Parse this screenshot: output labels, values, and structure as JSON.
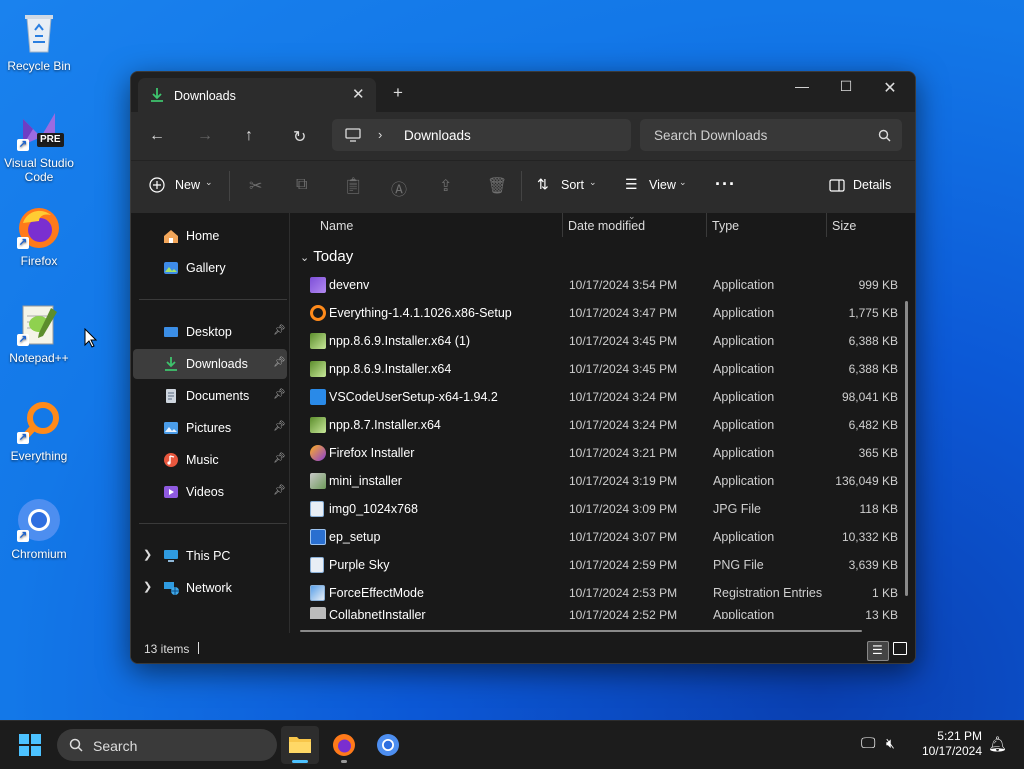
{
  "desktop": {
    "icons": [
      {
        "label": "Recycle Bin"
      },
      {
        "label": "Visual Studio Code"
      },
      {
        "label": "Firefox"
      },
      {
        "label": "Notepad++"
      },
      {
        "label": "Everything"
      },
      {
        "label": "Chromium"
      }
    ],
    "vscode_badge": "PRE"
  },
  "window": {
    "tab_title": "Downloads",
    "address": {
      "location": "Downloads"
    },
    "search": {
      "placeholder": "Search Downloads"
    },
    "commands": {
      "new": "New",
      "sort": "Sort",
      "view": "View",
      "details": "Details"
    },
    "nav": {
      "items": [
        {
          "label": "Home"
        },
        {
          "label": "Gallery"
        },
        {
          "label": "Desktop"
        },
        {
          "label": "Downloads"
        },
        {
          "label": "Documents"
        },
        {
          "label": "Pictures"
        },
        {
          "label": "Music"
        },
        {
          "label": "Videos"
        },
        {
          "label": "This PC"
        },
        {
          "label": "Network"
        }
      ]
    },
    "columns": [
      "Name",
      "Date modified",
      "Type",
      "Size"
    ],
    "group": "Today",
    "files": [
      {
        "name": "devenv",
        "date": "10/17/2024 3:54 PM",
        "type": "Application",
        "size": "999 KB"
      },
      {
        "name": "Everything-1.4.1.1026.x86-Setup",
        "date": "10/17/2024 3:47 PM",
        "type": "Application",
        "size": "1,775 KB"
      },
      {
        "name": "npp.8.6.9.Installer.x64 (1)",
        "date": "10/17/2024 3:45 PM",
        "type": "Application",
        "size": "6,388 KB"
      },
      {
        "name": "npp.8.6.9.Installer.x64",
        "date": "10/17/2024 3:45 PM",
        "type": "Application",
        "size": "6,388 KB"
      },
      {
        "name": "VSCodeUserSetup-x64-1.94.2",
        "date": "10/17/2024 3:24 PM",
        "type": "Application",
        "size": "98,041 KB"
      },
      {
        "name": "npp.8.7.Installer.x64",
        "date": "10/17/2024 3:24 PM",
        "type": "Application",
        "size": "6,482 KB"
      },
      {
        "name": "Firefox Installer",
        "date": "10/17/2024 3:21 PM",
        "type": "Application",
        "size": "365 KB"
      },
      {
        "name": "mini_installer",
        "date": "10/17/2024 3:19 PM",
        "type": "Application",
        "size": "136,049 KB"
      },
      {
        "name": "img0_1024x768",
        "date": "10/17/2024 3:09 PM",
        "type": "JPG File",
        "size": "118 KB"
      },
      {
        "name": "ep_setup",
        "date": "10/17/2024 3:07 PM",
        "type": "Application",
        "size": "10,332 KB"
      },
      {
        "name": "Purple Sky",
        "date": "10/17/2024 2:59 PM",
        "type": "PNG File",
        "size": "3,639 KB"
      },
      {
        "name": "ForceEffectMode",
        "date": "10/17/2024 2:53 PM",
        "type": "Registration Entries",
        "size": "1 KB"
      },
      {
        "name": "CollabnetInstaller",
        "date": "10/17/2024 2:52 PM",
        "type": "Application",
        "size": "13 KB"
      }
    ],
    "status": {
      "count": "13 items"
    }
  },
  "taskbar": {
    "search_placeholder": "Search",
    "time": "5:21 PM",
    "date": "10/17/2024"
  }
}
